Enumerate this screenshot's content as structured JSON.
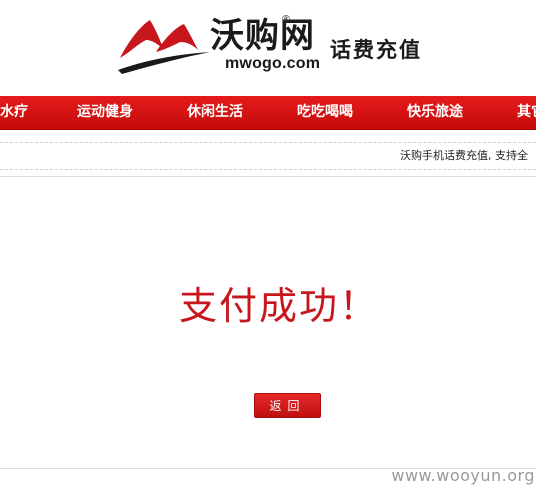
{
  "header": {
    "logo_cn": "沃购网",
    "logo_reg": "®",
    "logo_domain": "mwogo.com",
    "slogan": "话费充值"
  },
  "nav": {
    "items": [
      {
        "label": "水疗"
      },
      {
        "label": "运动健身"
      },
      {
        "label": "休闲生活"
      },
      {
        "label": "吃吃喝喝"
      },
      {
        "label": "快乐旅途"
      },
      {
        "label": "其它"
      }
    ]
  },
  "notice": {
    "text": "沃购手机话费充值, 支持全"
  },
  "result": {
    "title": "支付成功！",
    "return_label": "返回"
  },
  "watermark": "www.wooyun.org",
  "colors": {
    "brand_red": "#c8161d",
    "nav_red": "#d91414"
  }
}
